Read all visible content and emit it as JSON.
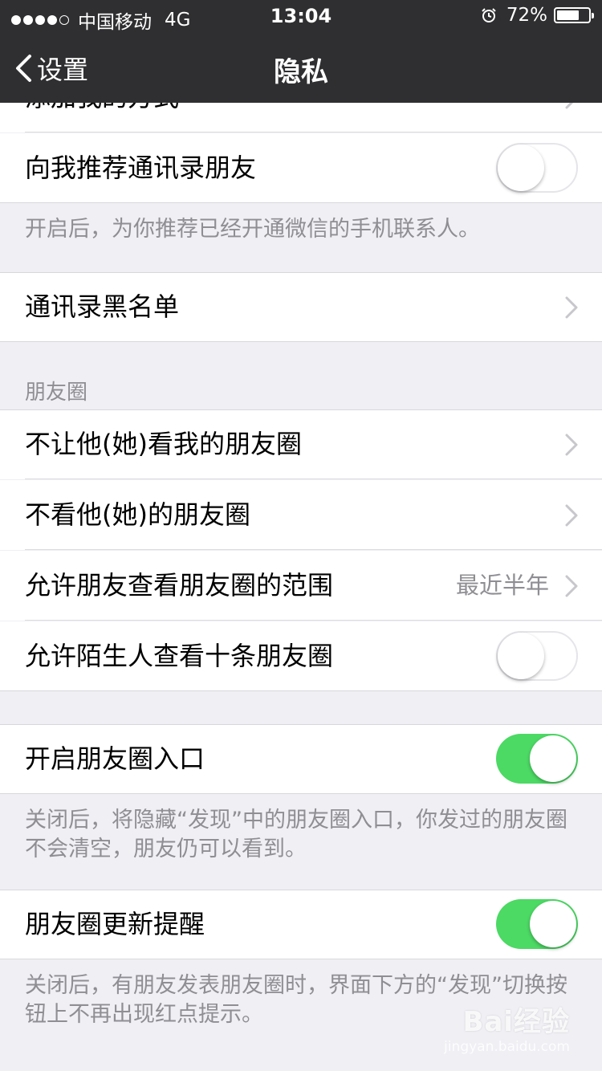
{
  "status_bar": {
    "carrier": "中国移动",
    "network": "4G",
    "time": "13:04",
    "battery_text": "72%",
    "battery_level": 0.72
  },
  "nav": {
    "back_label": "设置",
    "title": "隐私"
  },
  "rows": {
    "partial_top": "添加我的方式",
    "recommend_contacts": {
      "label": "向我推荐通讯录朋友",
      "on": false
    },
    "recommend_note": "开启后，为你推荐已经开通微信的手机联系人。",
    "blacklist": {
      "label": "通讯录黑名单"
    }
  },
  "moments": {
    "section_title": "朋友圈",
    "items": [
      {
        "label": "不让他(她)看我的朋友圈"
      },
      {
        "label": "不看他(她)的朋友圈"
      },
      {
        "label": "允许朋友查看朋友圈的范围",
        "value": "最近半年"
      },
      {
        "label": "允许陌生人查看十条朋友圈",
        "on": false
      }
    ]
  },
  "entrance": {
    "label": "开启朋友圈入口",
    "on": true,
    "note": "关闭后，将隐藏“发现”中的朋友圈入口，你发过的朋友圈不会清空，朋友仍可以看到。"
  },
  "update_reminder": {
    "label": "朋友圈更新提醒",
    "on": true,
    "note": "关闭后，有朋友发表朋友圈时，界面下方的“发现”切换按钮上不再出现红点提示。"
  },
  "watermark": {
    "text": "Bai经验",
    "url": "jingyan.baidu.com"
  },
  "colors": {
    "bar_bg": "#2f2f31",
    "page_bg": "#efeff4",
    "toggle_on": "#4cd964",
    "secondary_text": "#8e8e93"
  }
}
